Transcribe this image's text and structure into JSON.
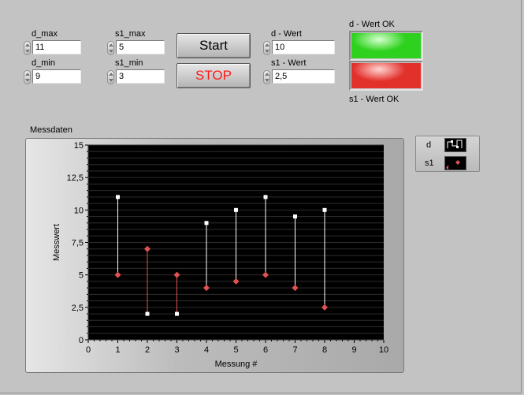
{
  "controls": {
    "d_max": {
      "label": "d_max",
      "value": "11"
    },
    "d_min": {
      "label": "d_min",
      "value": "9"
    },
    "s1_max": {
      "label": "s1_max",
      "value": "5"
    },
    "s1_min": {
      "label": "s1_min",
      "value": "3"
    },
    "d_wert": {
      "label": "d - Wert",
      "value": "10"
    },
    "s1_wert": {
      "label": "s1 - Wert",
      "value": "2,5"
    }
  },
  "buttons": {
    "start": "Start",
    "stop": "STOP"
  },
  "indicators": {
    "d_ok": {
      "label": "d - Wert OK",
      "color": "#2ed21e"
    },
    "s1_ok": {
      "label": "s1 - Wert OK",
      "color": "#e2302b"
    }
  },
  "graph": {
    "title": "Messdaten"
  },
  "legend": [
    {
      "name": "d"
    },
    {
      "name": "s1"
    }
  ],
  "chart_data": {
    "type": "scatter",
    "xlabel": "Messung #",
    "ylabel": "Messwert",
    "xlim": [
      0,
      10
    ],
    "ylim": [
      0,
      15
    ],
    "x_ticks": [
      "0",
      "1",
      "2",
      "3",
      "4",
      "5",
      "6",
      "7",
      "8",
      "9",
      "10"
    ],
    "y_ticks": [
      "0",
      "2,5",
      "5",
      "7,5",
      "10",
      "12,5",
      "15"
    ],
    "grid": "horizontal minor",
    "x": [
      1,
      2,
      3,
      4,
      5,
      6,
      7,
      8
    ],
    "series": [
      {
        "name": "d",
        "values": [
          11,
          2,
          2,
          9,
          10,
          11,
          9.5,
          10
        ],
        "color": "#ffffff",
        "marker": "square"
      },
      {
        "name": "s1",
        "values": [
          5,
          7,
          5,
          4,
          4.5,
          5,
          4,
          2.5
        ],
        "color": "#e05252",
        "marker": "diamond"
      }
    ],
    "connectors": {
      "color_default": "#ffffff",
      "color_when_s1_above": "#e05252"
    }
  }
}
